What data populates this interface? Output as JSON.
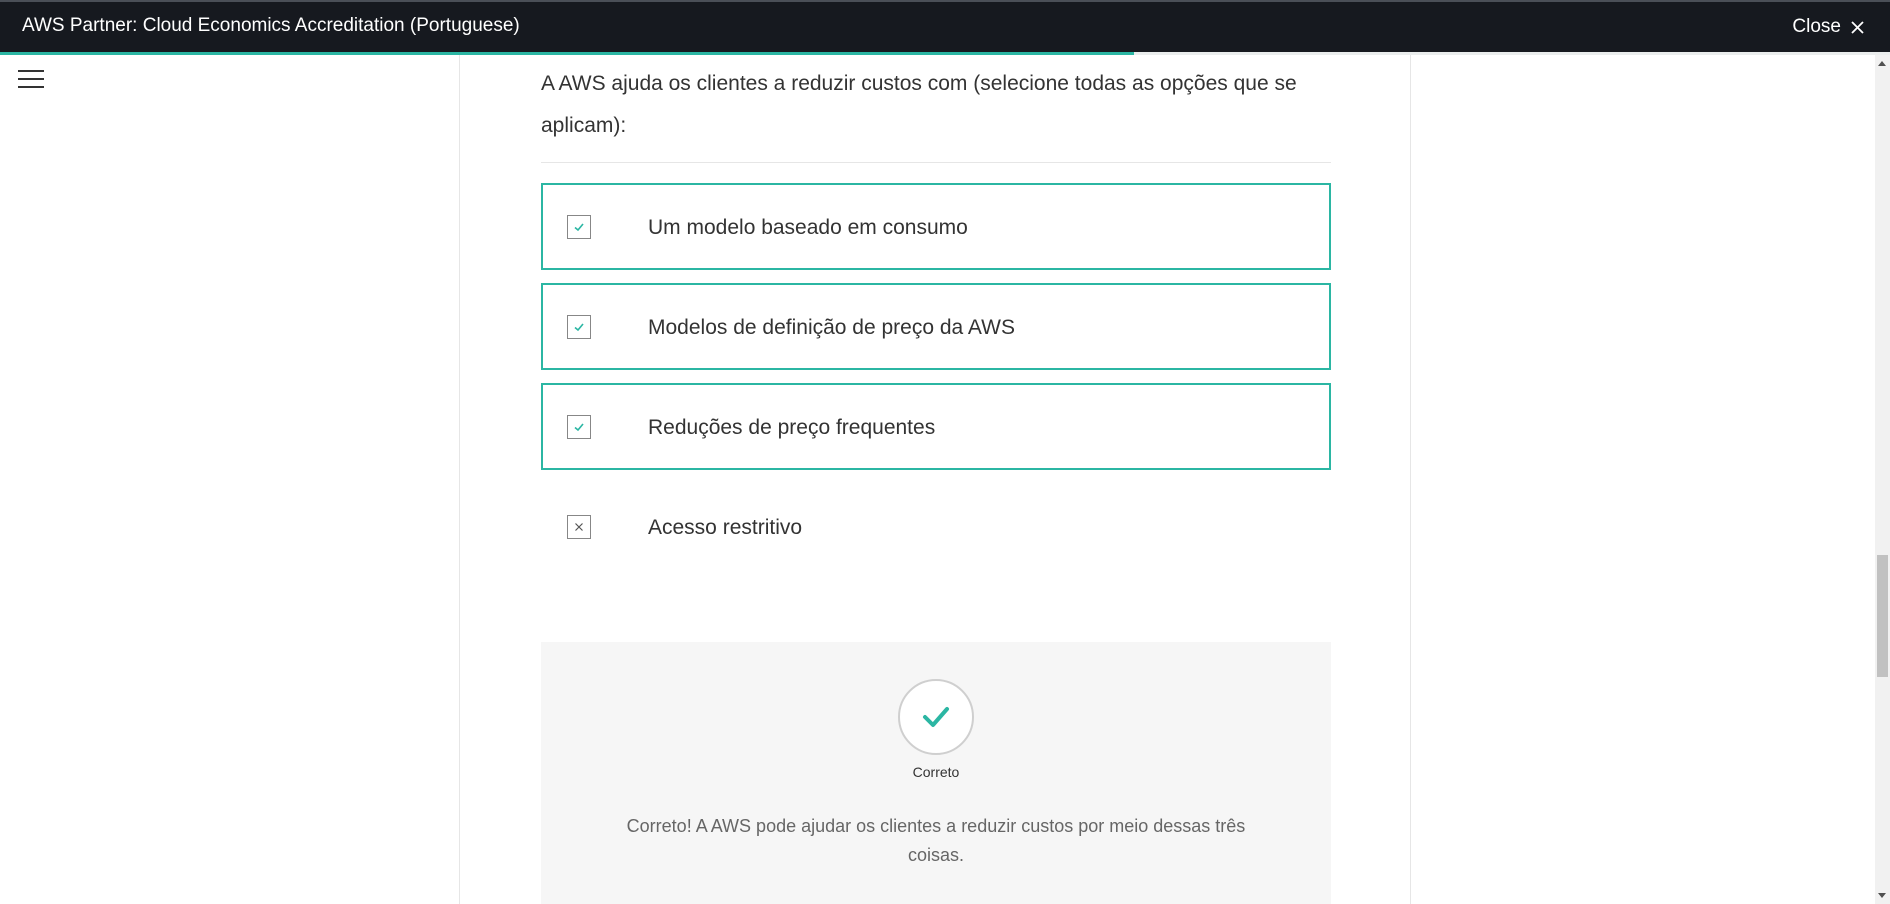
{
  "header": {
    "title": "AWS Partner: Cloud Economics Accreditation (Portuguese)",
    "close_label": "Close",
    "progress_fraction": 0.6
  },
  "question": {
    "text": "A AWS ajuda os clientes a reduzir custos com (selecione todas as opções que se aplicam):"
  },
  "options": [
    {
      "label": "Um modelo baseado em consumo",
      "state": "checked",
      "icon": "check-icon"
    },
    {
      "label": "Modelos de definição de preço da AWS",
      "state": "checked",
      "icon": "check-icon"
    },
    {
      "label": "Reduções de preço frequentes",
      "state": "checked",
      "icon": "check-icon"
    },
    {
      "label": "Acesso restritivo",
      "state": "incorrect",
      "icon": "x-icon"
    }
  ],
  "feedback": {
    "status": "Correto",
    "message": "Correto! A AWS pode ajudar os clientes a reduzir custos por meio dessas três coisas."
  },
  "colors": {
    "accent": "#2bb6a3",
    "topbar": "#16191f"
  }
}
